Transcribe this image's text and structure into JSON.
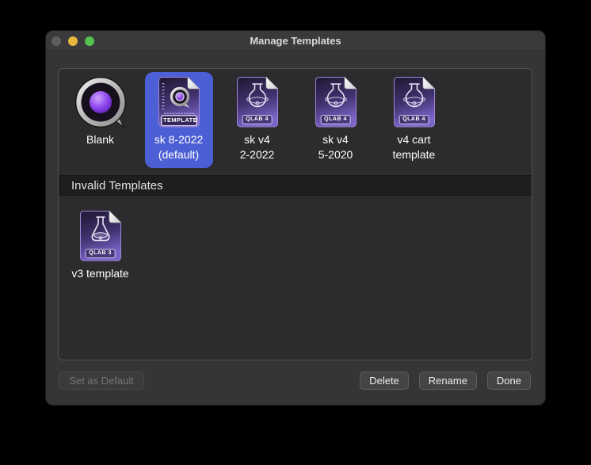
{
  "window": {
    "title": "Manage Templates"
  },
  "list": {
    "valid_items": [
      {
        "line1": "Blank",
        "line2": "",
        "badge": "",
        "selected": false,
        "icon": "qlab-app-icon"
      },
      {
        "line1": "sk 8-2022",
        "line2": "(default)",
        "badge": "TEMPLATE",
        "selected": true,
        "icon": "qlab-template-document-icon"
      },
      {
        "line1": "sk v4",
        "line2": "2-2022",
        "badge": "QLAB 4",
        "selected": false,
        "icon": "qlab4-document-icon"
      },
      {
        "line1": "sk v4",
        "line2": "5-2020",
        "badge": "QLAB 4",
        "selected": false,
        "icon": "qlab4-document-icon"
      },
      {
        "line1": "v4 cart",
        "line2": "template",
        "badge": "QLAB 4",
        "selected": false,
        "icon": "qlab4-document-icon"
      }
    ],
    "invalid_header": "Invalid Templates",
    "invalid_items": [
      {
        "line1": "v3 template",
        "line2": "",
        "badge": "QLAB 3",
        "selected": false,
        "icon": "qlab3-document-icon"
      }
    ]
  },
  "footer": {
    "set_default_label": "Set as Default",
    "delete_label": "Delete",
    "rename_label": "Rename",
    "done_label": "Done"
  },
  "colors": {
    "selection_blue": "#4d5fd4",
    "traffic_close_disabled": "#5d5d5d",
    "traffic_minimize_yellow": "#e9b73e",
    "traffic_zoom_green": "#55c14f"
  }
}
